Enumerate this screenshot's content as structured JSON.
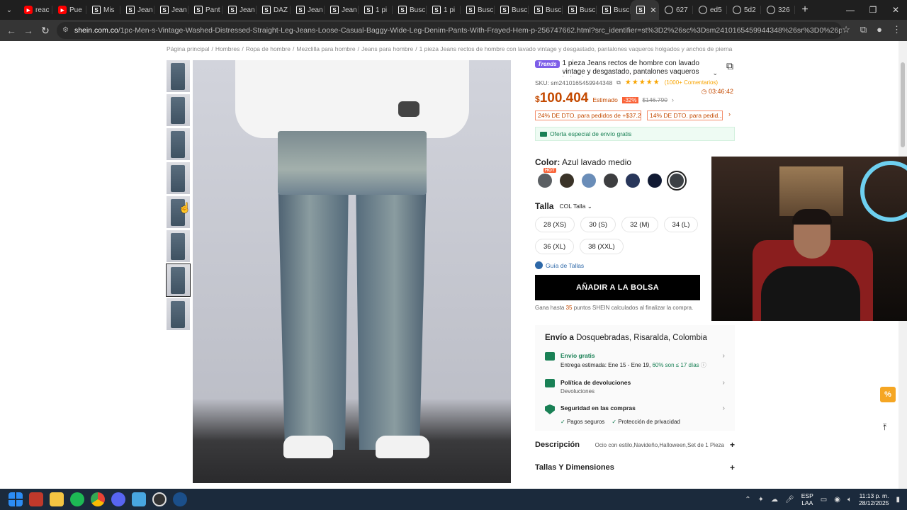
{
  "browser": {
    "tabs": [
      {
        "label": "reac",
        "icon": "youtube-icon"
      },
      {
        "label": "Pue",
        "icon": "youtube-icon"
      },
      {
        "label": "Mis",
        "icon": "shein-icon"
      },
      {
        "label": "Jean",
        "icon": "shein-icon"
      },
      {
        "label": "Jean",
        "icon": "shein-icon"
      },
      {
        "label": "Pant",
        "icon": "shein-icon"
      },
      {
        "label": "Jean",
        "icon": "shein-icon"
      },
      {
        "label": "DAZ",
        "icon": "shein-icon"
      },
      {
        "label": "Jean",
        "icon": "shein-icon"
      },
      {
        "label": "Jean",
        "icon": "shein-icon"
      },
      {
        "label": "1 pi",
        "icon": "shein-icon"
      },
      {
        "label": "Busc",
        "icon": "shein-icon"
      },
      {
        "label": "1 pi",
        "icon": "shein-icon"
      },
      {
        "label": "Busc",
        "icon": "shein-icon"
      },
      {
        "label": "Busc",
        "icon": "shein-icon"
      },
      {
        "label": "Busc",
        "icon": "shein-icon"
      },
      {
        "label": "Busc",
        "icon": "shein-icon"
      },
      {
        "label": "Busc",
        "icon": "shein-icon"
      }
    ],
    "active_tab_close": "✕",
    "after_tabs": [
      {
        "label": "627",
        "icon": "globe-icon"
      },
      {
        "label": "ed5",
        "icon": "globe-icon"
      },
      {
        "label": "5d2",
        "icon": "globe-icon"
      },
      {
        "label": "326",
        "icon": "globe-icon"
      }
    ],
    "new_tab": "+",
    "url_host": "shein.com.co",
    "url_path": "/1pc-Men-s-Vintage-Washed-Distressed-Straight-Leg-Jeans-Loose-Casual-Baggy-Wide-Leg-Denim-Pants-With-Frayed-Hem-p-256747662.html?src_identifier=st%3D2%26sc%3Dsm2410165459944348%26sr%3D0%26ps%3D1&src_module=se..."
  },
  "breadcrumb": [
    "Página principal",
    "Hombres",
    "Ropa de hombre",
    "Mezclilla para hombre",
    "Jeans para hombre",
    "1 pieza Jeans rectos de hombre con lavado vintage y desgastado, pantalones vaqueros holgados y anchos de pierna con bajo d..."
  ],
  "product": {
    "badge": "Trends",
    "title": "1 pieza Jeans rectos de hombre con lavado vintage y desgastado, pantalones vaqueros holgados y...",
    "sku": "SKU: sm2410165459944348",
    "stars": "★★★★★",
    "rating_fraction": 0.9,
    "reviews": "(1000+ Comentarios)",
    "currency": "$",
    "price": "100.404",
    "estimated_label": "Estimado",
    "discount": "-32%",
    "old_price": "$146.790",
    "timer": "03:46:42",
    "promo1": "24% DE DTO. para pedidos de +$37.235",
    "promo2": "14% DE DTO. para pedid...",
    "free_shipping": "Oferta especial de envío gratis",
    "color_label": "Color:",
    "color_value": "Azul lavado medio",
    "hot_tag": "HOT",
    "swatch_colors": [
      "#5b5f63",
      "#3a3328",
      "#6a8db8",
      "#3d3e40",
      "#28365a",
      "#111a33",
      "#3c4045"
    ],
    "size_label": "Talla",
    "size_system": "COL Talla",
    "sizes": [
      "28 (XS)",
      "30 (S)",
      "32 (M)",
      "34 (L)",
      "36 (XL)",
      "38 (XXL)"
    ],
    "size_guide": "Guía de Tallas",
    "add_to_bag": "AÑADIR A LA BOLSA",
    "points_prefix": "Gana hasta",
    "points_value": "35",
    "points_suffix": "puntos SHEIN calculados al finalizar la compra."
  },
  "shipping": {
    "title_prefix": "Envío a",
    "destination": "Dosquebradas, Risaralda, Colombia",
    "free_title": "Envío gratis",
    "delivery_prefix": "Entrega estimada: Ene 15 - Ene 19,",
    "delivery_pct": "60% son ≤ 17 días",
    "returns_title": "Política de devoluciones",
    "returns_sub": "Devoluciones",
    "security_title": "Seguridad en las compras",
    "check1": "Pagos seguros",
    "check2": "Protección de privacidad"
  },
  "accordions": {
    "description_title": "Descripción",
    "description_tags": "Ocio con estilo,Navideño,Halloween,Set de 1 Pieza",
    "sizes_title": "Tallas Y Dimensiones"
  },
  "taskbar": {
    "lang": "ESP",
    "lang2": "LAA",
    "time": "11:13 p. m.",
    "date": "28/12/2025"
  },
  "colors": {
    "price": "#c44a01",
    "accent_green": "#198055",
    "trends": "#7d5ee8"
  }
}
